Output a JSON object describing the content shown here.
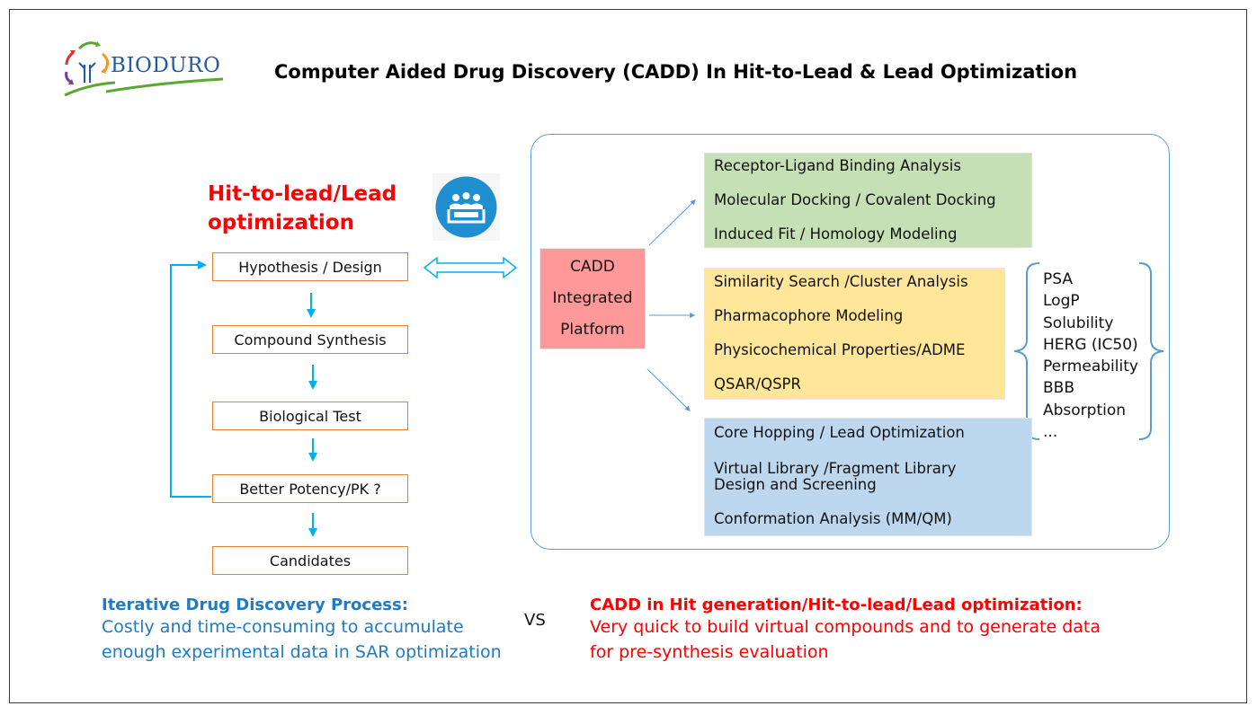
{
  "logo": {
    "text": "BIODURO",
    "icon": "tree-cycle-arrows-icon"
  },
  "title": "Computer Aided Drug Discovery (CADD) In Hit-to-Lead & Lead Optimization",
  "left_section": {
    "heading_line1": "Hit-to-lead/Lead",
    "heading_line2": "optimization",
    "icon": "meeting-people-icon",
    "flow": [
      "Hypothesis / Design",
      "Compound Synthesis",
      "Biological Test",
      "Better Potency/PK ?",
      "Candidates"
    ],
    "loop_back_from": "Better Potency/PK ?",
    "loop_back_to": "Hypothesis / Design"
  },
  "cadd_platform": {
    "line1": "CADD",
    "line2": "Integrated",
    "line3": "Platform"
  },
  "tool_groups": [
    {
      "color": "#c5e0b4",
      "items": [
        "Receptor-Ligand Binding Analysis",
        "Molecular Docking / Covalent Docking",
        "Induced Fit / Homology Modeling"
      ]
    },
    {
      "color": "#ffe699",
      "items": [
        "Similarity Search /Cluster Analysis",
        "Pharmacophore Modeling",
        "Physicochemical Properties/ADME",
        "QSAR/QSPR"
      ]
    },
    {
      "color": "#bdd7ee",
      "items": [
        "Core Hopping / Lead Optimization",
        "Virtual Library /Fragment Library",
        "Design and Screening",
        "Conformation Analysis (MM/QM)"
      ]
    }
  ],
  "properties": [
    "PSA",
    "LogP",
    "Solubility",
    "HERG (IC50)",
    "Permeability",
    "BBB",
    "Absorption",
    "..."
  ],
  "bottom_left": {
    "heading": "Iterative Drug Discovery Process:",
    "line1": "Costly and time-consuming to accumulate",
    "line2": "enough experimental data in SAR optimization"
  },
  "vs": "VS",
  "bottom_right": {
    "heading": "CADD in Hit generation/Hit-to-lead/Lead optimization:",
    "line1": "Very quick to build virtual compounds and to generate data",
    "line2": "for pre-synthesis evaluation"
  },
  "colors": {
    "title_red": "#ff0000",
    "flow_border": "#ed7d31",
    "arrow_blue": "#00b0f0",
    "panel_border": "#5b9bd5",
    "cadd_fill": "#ff9999",
    "text_blue": "#1f7bc2",
    "logo_blue": "#1f5aa6"
  }
}
